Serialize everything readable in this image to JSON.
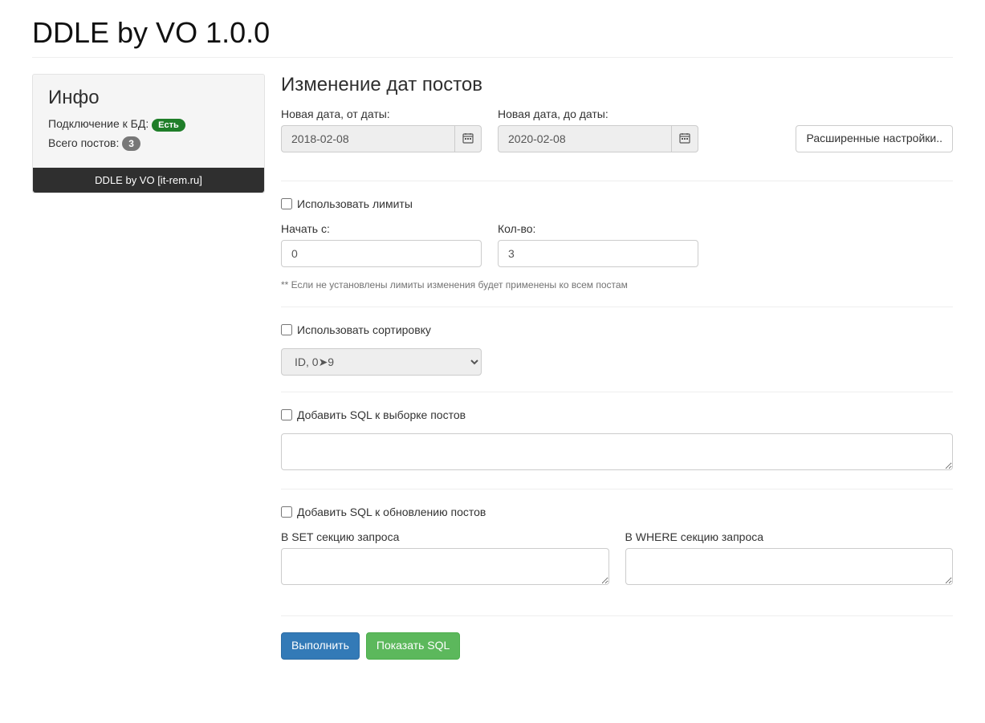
{
  "header": {
    "title": "DDLE by VO 1.0.0"
  },
  "sidebar": {
    "info_title": "Инфо",
    "db_label": "Подключение к БД:",
    "db_status": "Есть",
    "posts_label": "Всего постов:",
    "posts_count": "3",
    "footer": "DDLE by VO [it-rem.ru]"
  },
  "main": {
    "title": "Изменение дат постов",
    "date_from_label": "Новая дата, от даты:",
    "date_from_value": "2018-02-08",
    "date_to_label": "Новая дата, до даты:",
    "date_to_value": "2020-02-08",
    "advanced_btn": "Расширенные настройки..",
    "limits": {
      "checkbox_label": "Использовать лимиты",
      "start_label": "Начать с:",
      "start_value": "0",
      "count_label": "Кол-во:",
      "count_value": "3",
      "help": "** Если не установлены лимиты изменения будет применены ко всем постам"
    },
    "sort": {
      "checkbox_label": "Использовать сортировку",
      "selected": "ID, 0➤9"
    },
    "sql_select": {
      "checkbox_label": "Добавить SQL к выборке постов"
    },
    "sql_update": {
      "checkbox_label": "Добавить SQL к обновлению постов",
      "set_label": "В SET секцию запроса",
      "where_label": "В WHERE секцию запроса"
    },
    "buttons": {
      "execute": "Выполнить",
      "show_sql": "Показать SQL"
    }
  }
}
